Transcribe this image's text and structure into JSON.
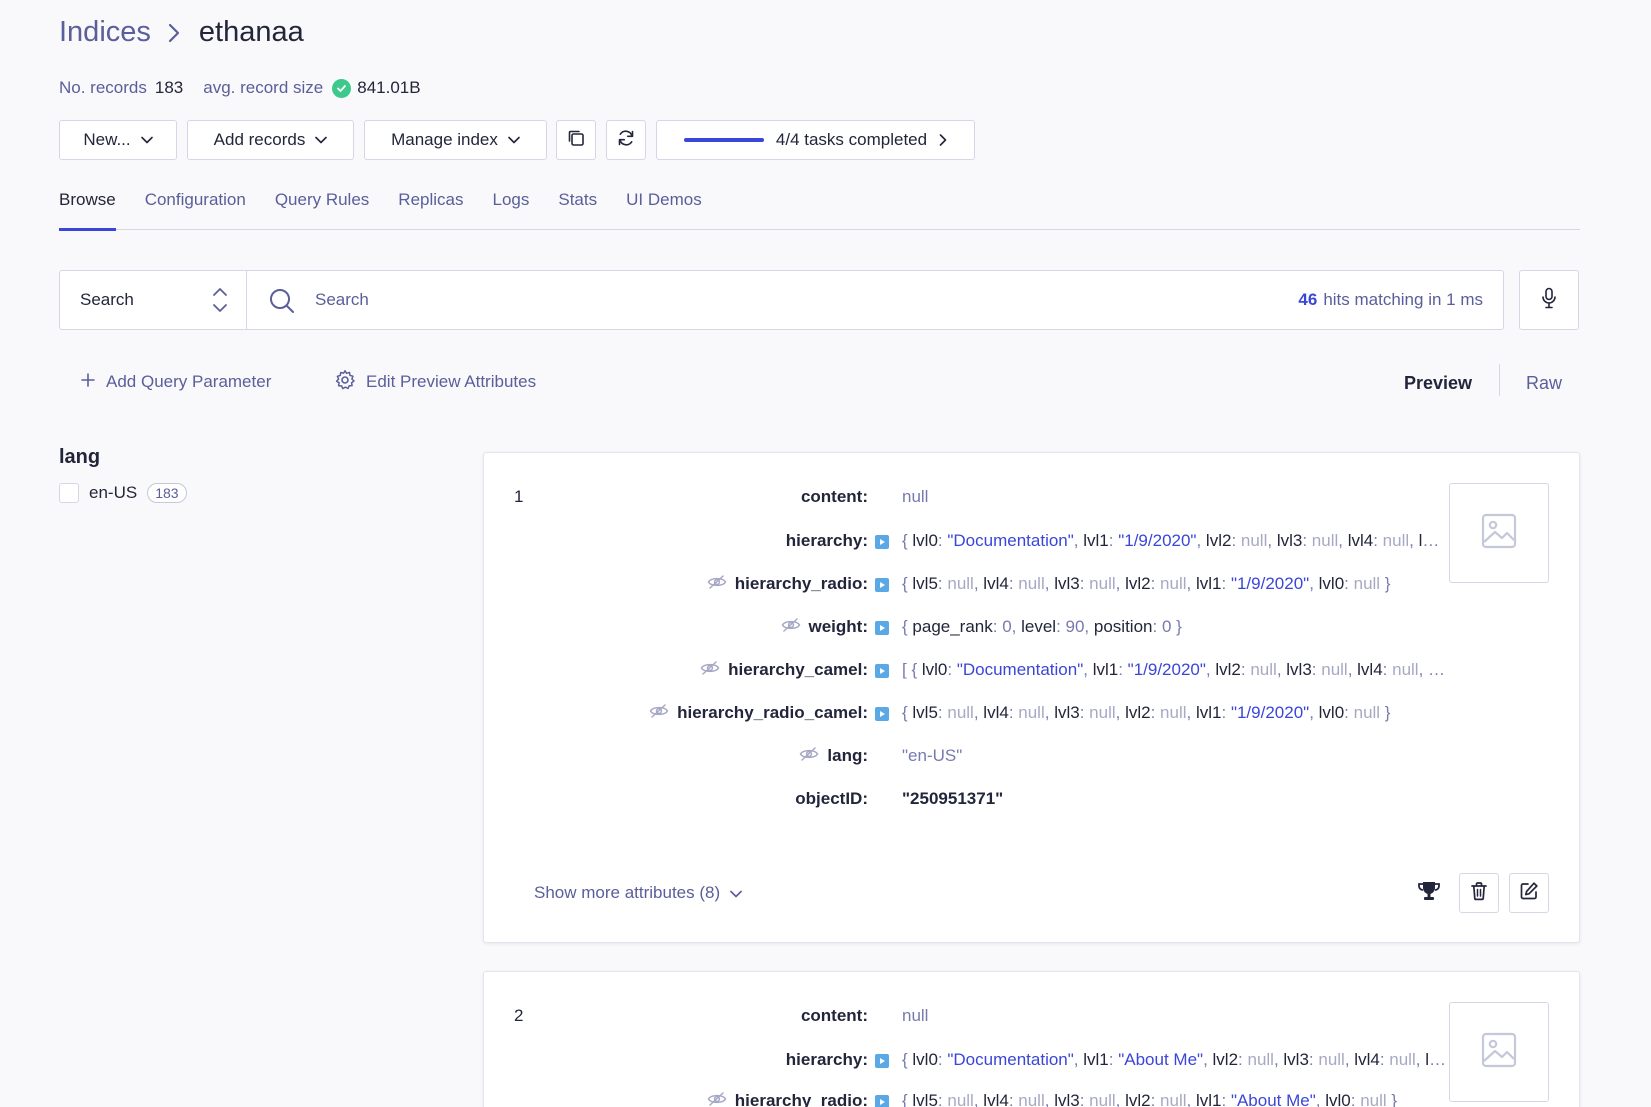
{
  "breadcrumb": {
    "root": "Indices",
    "current": "ethanaa"
  },
  "stats": {
    "records_label": "No. records",
    "records_value": "183",
    "size_label": "avg. record size",
    "size_value": "841.01B"
  },
  "toolbar": {
    "new_label": "New...",
    "add_records_label": "Add records",
    "manage_index_label": "Manage index",
    "tasks_label": "4/4 tasks completed",
    "tasks_progress": 1.0
  },
  "tabs": [
    "Browse",
    "Configuration",
    "Query Rules",
    "Replicas",
    "Logs",
    "Stats",
    "UI Demos"
  ],
  "search": {
    "mode": "Search",
    "placeholder": "Search",
    "hits_count": "46",
    "hits_text": "hits matching in 1 ms"
  },
  "actions": {
    "add_param": "Add Query Parameter",
    "edit_preview": "Edit Preview Attributes",
    "preview": "Preview",
    "raw": "Raw"
  },
  "facets": {
    "title": "lang",
    "items": [
      {
        "label": "en-US",
        "count": "183"
      }
    ]
  },
  "hits": [
    {
      "number": "1",
      "attrs": {
        "content_key": "content:",
        "content_val": "null",
        "hierarchy_key": "hierarchy:",
        "hierarchy_radio_key": "hierarchy_radio:",
        "weight_key": "weight:",
        "hierarchy_camel_key": "hierarchy_camel:",
        "hierarchy_radio_camel_key": "hierarchy_radio_camel:",
        "lang_key": "lang:",
        "lang_val": "\"en-US\"",
        "objectid_key": "objectID:",
        "objectid_val": "\"250951371\""
      },
      "show_more": "Show more attributes (8)"
    },
    {
      "number": "2",
      "attrs": {
        "content_key": "content:",
        "content_val": "null",
        "hierarchy_key": "hierarchy:",
        "hierarchy_radio_key": "hierarchy_radio:"
      }
    }
  ],
  "colors": {
    "accent": "#3a46d8",
    "success": "#3cc98b",
    "muted": "#5a5e9a",
    "border": "#d6d6e7"
  }
}
